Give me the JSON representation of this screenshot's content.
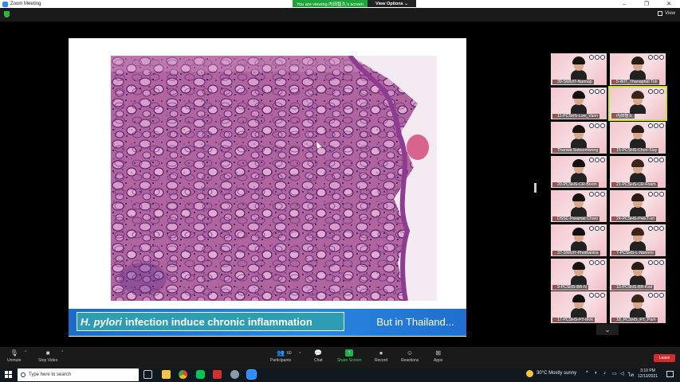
{
  "window": {
    "title": "Zoom Meeting"
  },
  "share_banner": {
    "message": "You are viewing 内田智久's screen",
    "options_label": "View Options ⌄"
  },
  "view_button": {
    "label": "View"
  },
  "slide": {
    "caption_left_italic": "H. pylori",
    "caption_left_rest": "infection induce chronic inflammation",
    "caption_right": "But in Thailand..."
  },
  "participants": [
    {
      "name": "39-SWUIT-Nunnap"
    },
    {
      "name": "5-WIT_Thanaphat Tob"
    },
    {
      "name": "11-PCSHS-Loei_Vann"
    },
    {
      "name": "内田智久"
    },
    {
      "name": "Thanwa Subsomwong"
    },
    {
      "name": "15-PCSHS-Chon-Siay"
    },
    {
      "name": "20-PCSHS-CR-Boom"
    },
    {
      "name": "21-PCSHS-CR-Foam"
    },
    {
      "name": "DSSC-Poramat Charo"
    },
    {
      "name": "24-PCSHS-PHET-un"
    },
    {
      "name": "37-SWUIT-Phothanisa"
    },
    {
      "name": "7-PCSHS-L-Nannmi"
    },
    {
      "name": "9-PCSHS-BR-N"
    },
    {
      "name": "10-PCSHS-BR-Kod"
    },
    {
      "name": "17-PCSHS-PT-Mok"
    },
    {
      "name": "18_PCSHS_PT_Pam"
    }
  ],
  "toolbar": {
    "unmute": "Unmute",
    "stop_video": "Stop Video",
    "participants": "Participants",
    "participants_count": "60",
    "chat": "Chat",
    "share_screen": "Share Screen",
    "record": "Record",
    "reactions": "Reactions",
    "apps": "Apps",
    "leave": "Leave"
  },
  "taskbar": {
    "search_placeholder": "Type here to search",
    "weather": "30°C  Mostly sunny",
    "time": "3:10 PM",
    "date": "12/13/2021"
  }
}
